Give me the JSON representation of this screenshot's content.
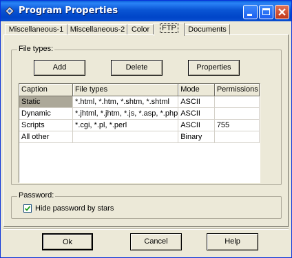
{
  "window": {
    "title": "Program Properties"
  },
  "tabs": [
    {
      "label": "Miscellaneous-1"
    },
    {
      "label": "Miscellaneous-2"
    },
    {
      "label": "Color"
    },
    {
      "label": "FTP"
    },
    {
      "label": "Documents"
    }
  ],
  "active_tab": "FTP",
  "file_types": {
    "group_label": "File types:",
    "add_label": "Add",
    "delete_label": "Delete",
    "properties_label": "Properties",
    "columns": [
      "Caption",
      "File types",
      "Mode",
      "Permissions"
    ],
    "rows": [
      {
        "caption": "Static",
        "types": "*.html, *.htm, *.shtm, *.shtml",
        "mode": "ASCII",
        "permissions": ""
      },
      {
        "caption": "Dynamic",
        "types": "*.jhtml, *.jhtm, *.js, *.asp, *.php",
        "mode": "ASCII",
        "permissions": ""
      },
      {
        "caption": "Scripts",
        "types": "*.cgi, *.pl, *.perl",
        "mode": "ASCII",
        "permissions": "755"
      },
      {
        "caption": "All other",
        "types": "",
        "mode": "Binary",
        "permissions": ""
      }
    ]
  },
  "password": {
    "group_label": "Password:",
    "hide_label": "Hide password by stars",
    "hide_checked": true
  },
  "buttons": {
    "ok": "Ok",
    "cancel": "Cancel",
    "help": "Help"
  },
  "icons": {
    "app": "diamond-icon",
    "minimize": "minimize-icon",
    "maximize": "maximize-icon",
    "close": "close-icon",
    "check": "checkmark-icon"
  },
  "colors": {
    "title_bar": "#0a55d4",
    "dialog_bg": "#ece9d8",
    "close_btn": "#c0371a",
    "selected_cell": "#aca899"
  }
}
